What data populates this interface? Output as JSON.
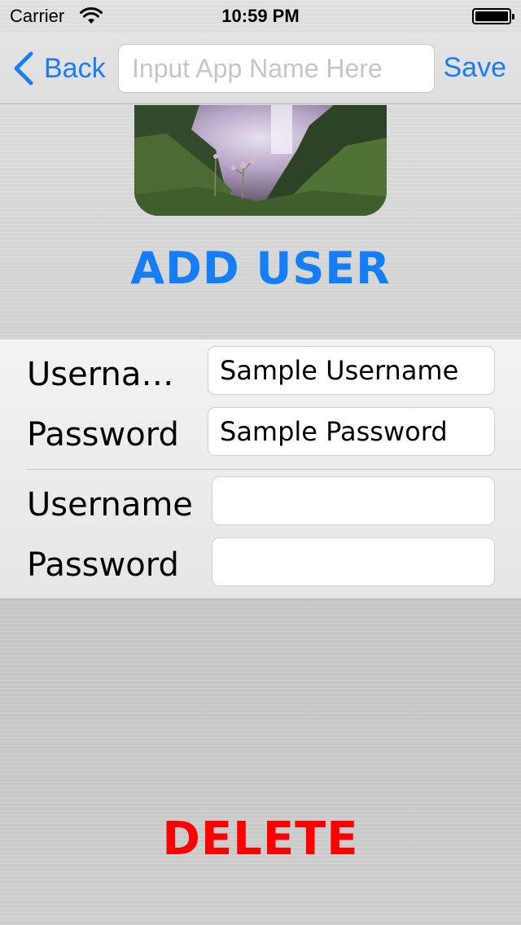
{
  "status_bar": {
    "carrier": "Carrier",
    "time": "10:59 PM",
    "wifi_icon": "wifi-icon",
    "battery_icon": "battery-icon"
  },
  "nav": {
    "back_label": "Back",
    "back_icon": "chevron-left-icon",
    "app_name_placeholder": "Input App Name Here",
    "app_name_value": "",
    "save_label": "Save"
  },
  "hero": {
    "description_icon": "landscape-image"
  },
  "add_user_label": "ADD USER",
  "credentials": [
    {
      "username_label": "Userna…",
      "username_value": "Sample Username",
      "password_label": "Password",
      "password_value": "Sample Password"
    },
    {
      "username_label": "Username",
      "username_value": "",
      "password_label": "Password",
      "password_value": ""
    }
  ],
  "delete_label": "DELETE",
  "colors": {
    "accent": "#157ef5",
    "destructive": "#ff0000"
  }
}
